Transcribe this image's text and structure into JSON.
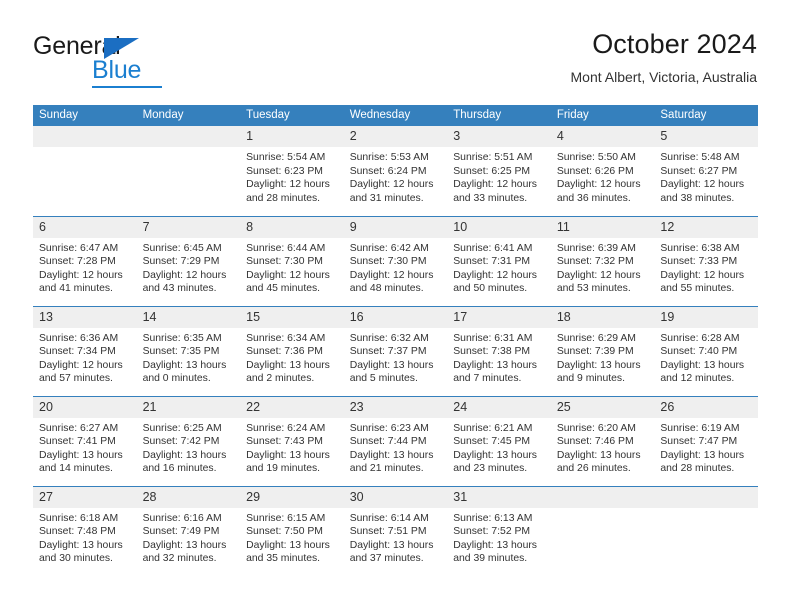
{
  "brand": {
    "name_top": "General",
    "name_bottom": "Blue",
    "accent_color": "#1b7fd0",
    "flag_color": "#1b6ec2"
  },
  "header": {
    "title": "October 2024",
    "subtitle": "Mont Albert, Victoria, Australia"
  },
  "theme": {
    "header_bg": "#3580bd",
    "header_text": "#ffffff",
    "daynum_bg": "#efefef",
    "row_border": "#3580bd",
    "body_text": "#333333"
  },
  "weekdays": [
    "Sunday",
    "Monday",
    "Tuesday",
    "Wednesday",
    "Thursday",
    "Friday",
    "Saturday"
  ],
  "calendar_data": {
    "month": "October",
    "year": 2024,
    "location": "Mont Albert, Victoria, Australia",
    "week_start": "Sunday",
    "weeks": [
      [
        {
          "day": "",
          "sunrise": "",
          "sunset": "",
          "daylight": ""
        },
        {
          "day": "",
          "sunrise": "",
          "sunset": "",
          "daylight": ""
        },
        {
          "day": "1",
          "sunrise": "Sunrise: 5:54 AM",
          "sunset": "Sunset: 6:23 PM",
          "daylight": "Daylight: 12 hours and 28 minutes."
        },
        {
          "day": "2",
          "sunrise": "Sunrise: 5:53 AM",
          "sunset": "Sunset: 6:24 PM",
          "daylight": "Daylight: 12 hours and 31 minutes."
        },
        {
          "day": "3",
          "sunrise": "Sunrise: 5:51 AM",
          "sunset": "Sunset: 6:25 PM",
          "daylight": "Daylight: 12 hours and 33 minutes."
        },
        {
          "day": "4",
          "sunrise": "Sunrise: 5:50 AM",
          "sunset": "Sunset: 6:26 PM",
          "daylight": "Daylight: 12 hours and 36 minutes."
        },
        {
          "day": "5",
          "sunrise": "Sunrise: 5:48 AM",
          "sunset": "Sunset: 6:27 PM",
          "daylight": "Daylight: 12 hours and 38 minutes."
        }
      ],
      [
        {
          "day": "6",
          "sunrise": "Sunrise: 6:47 AM",
          "sunset": "Sunset: 7:28 PM",
          "daylight": "Daylight: 12 hours and 41 minutes."
        },
        {
          "day": "7",
          "sunrise": "Sunrise: 6:45 AM",
          "sunset": "Sunset: 7:29 PM",
          "daylight": "Daylight: 12 hours and 43 minutes."
        },
        {
          "day": "8",
          "sunrise": "Sunrise: 6:44 AM",
          "sunset": "Sunset: 7:30 PM",
          "daylight": "Daylight: 12 hours and 45 minutes."
        },
        {
          "day": "9",
          "sunrise": "Sunrise: 6:42 AM",
          "sunset": "Sunset: 7:30 PM",
          "daylight": "Daylight: 12 hours and 48 minutes."
        },
        {
          "day": "10",
          "sunrise": "Sunrise: 6:41 AM",
          "sunset": "Sunset: 7:31 PM",
          "daylight": "Daylight: 12 hours and 50 minutes."
        },
        {
          "day": "11",
          "sunrise": "Sunrise: 6:39 AM",
          "sunset": "Sunset: 7:32 PM",
          "daylight": "Daylight: 12 hours and 53 minutes."
        },
        {
          "day": "12",
          "sunrise": "Sunrise: 6:38 AM",
          "sunset": "Sunset: 7:33 PM",
          "daylight": "Daylight: 12 hours and 55 minutes."
        }
      ],
      [
        {
          "day": "13",
          "sunrise": "Sunrise: 6:36 AM",
          "sunset": "Sunset: 7:34 PM",
          "daylight": "Daylight: 12 hours and 57 minutes."
        },
        {
          "day": "14",
          "sunrise": "Sunrise: 6:35 AM",
          "sunset": "Sunset: 7:35 PM",
          "daylight": "Daylight: 13 hours and 0 minutes."
        },
        {
          "day": "15",
          "sunrise": "Sunrise: 6:34 AM",
          "sunset": "Sunset: 7:36 PM",
          "daylight": "Daylight: 13 hours and 2 minutes."
        },
        {
          "day": "16",
          "sunrise": "Sunrise: 6:32 AM",
          "sunset": "Sunset: 7:37 PM",
          "daylight": "Daylight: 13 hours and 5 minutes."
        },
        {
          "day": "17",
          "sunrise": "Sunrise: 6:31 AM",
          "sunset": "Sunset: 7:38 PM",
          "daylight": "Daylight: 13 hours and 7 minutes."
        },
        {
          "day": "18",
          "sunrise": "Sunrise: 6:29 AM",
          "sunset": "Sunset: 7:39 PM",
          "daylight": "Daylight: 13 hours and 9 minutes."
        },
        {
          "day": "19",
          "sunrise": "Sunrise: 6:28 AM",
          "sunset": "Sunset: 7:40 PM",
          "daylight": "Daylight: 13 hours and 12 minutes."
        }
      ],
      [
        {
          "day": "20",
          "sunrise": "Sunrise: 6:27 AM",
          "sunset": "Sunset: 7:41 PM",
          "daylight": "Daylight: 13 hours and 14 minutes."
        },
        {
          "day": "21",
          "sunrise": "Sunrise: 6:25 AM",
          "sunset": "Sunset: 7:42 PM",
          "daylight": "Daylight: 13 hours and 16 minutes."
        },
        {
          "day": "22",
          "sunrise": "Sunrise: 6:24 AM",
          "sunset": "Sunset: 7:43 PM",
          "daylight": "Daylight: 13 hours and 19 minutes."
        },
        {
          "day": "23",
          "sunrise": "Sunrise: 6:23 AM",
          "sunset": "Sunset: 7:44 PM",
          "daylight": "Daylight: 13 hours and 21 minutes."
        },
        {
          "day": "24",
          "sunrise": "Sunrise: 6:21 AM",
          "sunset": "Sunset: 7:45 PM",
          "daylight": "Daylight: 13 hours and 23 minutes."
        },
        {
          "day": "25",
          "sunrise": "Sunrise: 6:20 AM",
          "sunset": "Sunset: 7:46 PM",
          "daylight": "Daylight: 13 hours and 26 minutes."
        },
        {
          "day": "26",
          "sunrise": "Sunrise: 6:19 AM",
          "sunset": "Sunset: 7:47 PM",
          "daylight": "Daylight: 13 hours and 28 minutes."
        }
      ],
      [
        {
          "day": "27",
          "sunrise": "Sunrise: 6:18 AM",
          "sunset": "Sunset: 7:48 PM",
          "daylight": "Daylight: 13 hours and 30 minutes."
        },
        {
          "day": "28",
          "sunrise": "Sunrise: 6:16 AM",
          "sunset": "Sunset: 7:49 PM",
          "daylight": "Daylight: 13 hours and 32 minutes."
        },
        {
          "day": "29",
          "sunrise": "Sunrise: 6:15 AM",
          "sunset": "Sunset: 7:50 PM",
          "daylight": "Daylight: 13 hours and 35 minutes."
        },
        {
          "day": "30",
          "sunrise": "Sunrise: 6:14 AM",
          "sunset": "Sunset: 7:51 PM",
          "daylight": "Daylight: 13 hours and 37 minutes."
        },
        {
          "day": "31",
          "sunrise": "Sunrise: 6:13 AM",
          "sunset": "Sunset: 7:52 PM",
          "daylight": "Daylight: 13 hours and 39 minutes."
        },
        {
          "day": "",
          "sunrise": "",
          "sunset": "",
          "daylight": ""
        },
        {
          "day": "",
          "sunrise": "",
          "sunset": "",
          "daylight": ""
        }
      ]
    ]
  }
}
